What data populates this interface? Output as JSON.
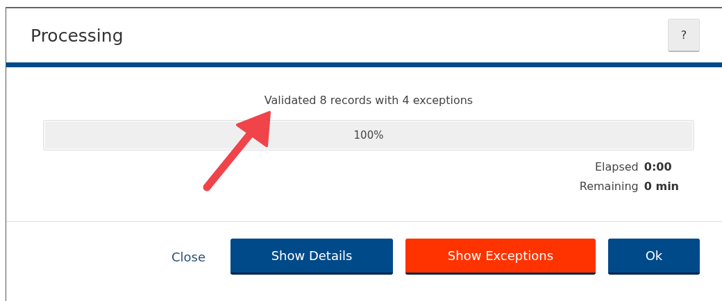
{
  "dialog": {
    "title": "Processing",
    "help_button": "?"
  },
  "message": "Validated 8 records with 4 exceptions",
  "progress": {
    "level": 1,
    "label": "100%"
  },
  "stats": [
    {
      "label": "Elapsed",
      "value": "0:00"
    },
    {
      "label": "Remaining",
      "value": "0 min"
    }
  ],
  "buttons": [
    {
      "label": "Close",
      "kind": "link"
    },
    {
      "label": "Show Details",
      "kind": "primary"
    },
    {
      "label": "Show Exceptions",
      "kind": "danger"
    },
    {
      "label": "Ok",
      "kind": "primary"
    }
  ]
}
